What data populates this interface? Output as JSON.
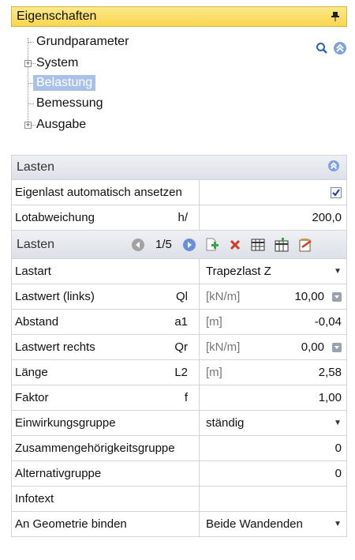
{
  "panel": {
    "title": "Eigenschaften"
  },
  "tree": {
    "items": [
      {
        "label": "Grundparameter",
        "expandable": false,
        "selected": false
      },
      {
        "label": "System",
        "expandable": true,
        "selected": false
      },
      {
        "label": "Belastung",
        "expandable": false,
        "selected": true
      },
      {
        "label": "Bemessung",
        "expandable": false,
        "selected": false
      },
      {
        "label": "Ausgabe",
        "expandable": true,
        "selected": false
      }
    ]
  },
  "section": {
    "title": "Lasten",
    "rows": [
      {
        "name": "Eigenlast automatisch ansetzen",
        "symbol": "",
        "checked": true
      },
      {
        "name": "Lotabweichung",
        "symbol": "h/",
        "value": "200,0"
      }
    ]
  },
  "loads": {
    "title": "Lasten",
    "counter": "1/5",
    "rows": [
      {
        "name": "Lastart",
        "symbol": "",
        "unit": "",
        "value": "Trapezlast Z",
        "dropdown": true
      },
      {
        "name": "Lastwert (links)",
        "symbol": "Ql",
        "unit": "[kN/m]",
        "value": "10,00",
        "spinner": true
      },
      {
        "name": "Abstand",
        "symbol": "a1",
        "unit": "[m]",
        "value": "-0,04"
      },
      {
        "name": "Lastwert rechts",
        "symbol": "Qr",
        "unit": "[kN/m]",
        "value": "0,00",
        "spinner": true
      },
      {
        "name": "Länge",
        "symbol": "L2",
        "unit": "[m]",
        "value": "2,58"
      },
      {
        "name": "Faktor",
        "symbol": "f",
        "unit": "",
        "value": "1,00"
      },
      {
        "name": "Einwirkungsgruppe",
        "symbol": "",
        "unit": "",
        "value": "ständig",
        "dropdown": true
      },
      {
        "name": "Zusammengehörigkeitsgruppe",
        "symbol": "",
        "unit": "",
        "value": "0"
      },
      {
        "name": "Alternativgruppe",
        "symbol": "",
        "unit": "",
        "value": "0"
      },
      {
        "name": "Infotext",
        "symbol": "",
        "unit": "",
        "value": ""
      },
      {
        "name": "An Geometrie binden",
        "symbol": "",
        "unit": "",
        "value": "Beide Wandenden",
        "dropdown": true
      }
    ]
  },
  "colors": {
    "header_yellow": "#f8d650",
    "selection": "#a9c1e8",
    "accent_blue": "#6a8fd6",
    "delete_red": "#d23a2a",
    "add_green": "#3aa545"
  },
  "icons": [
    "pin-icon",
    "search-icon",
    "collapse-icon",
    "prev-icon",
    "next-icon",
    "add-icon",
    "delete-icon",
    "table-icon",
    "table-edit-icon",
    "notes-icon"
  ]
}
